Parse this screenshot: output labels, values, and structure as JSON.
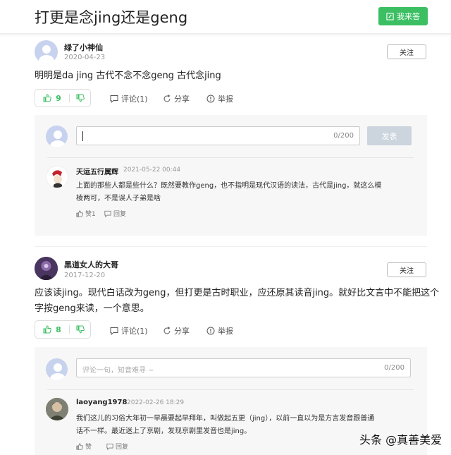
{
  "header": {
    "title": "打更是念jing还是geng",
    "answer_label": "我来答"
  },
  "answers": [
    {
      "user": "绿了小神仙",
      "date": "2020-04-23",
      "follow": "关注",
      "content": "明明是da jing 古代不念不念geng 古代念jing",
      "likes": "9",
      "comment": "评论(1)",
      "share": "分享",
      "report": "举报",
      "input_count": "0/200",
      "publish": "发表",
      "reply": {
        "user": "天运五行属辉",
        "date": "2021-05-22 00:44",
        "text_line1": "上面的那些人都是些什么？既然要教作geng，也不指明是现代汉语的读法，古代是jing，就这么模",
        "text_line2": "棱两可，不是误人子弟是啥",
        "like": "赞1",
        "reply": "回复"
      }
    },
    {
      "user": "黑道女人的大哥",
      "date": "2017-12-20",
      "follow": "关注",
      "content_line1": "应该读jing。现代白话改为geng，但打更是古时职业，应还原其读音jing。就好比文言中不能把这个",
      "content_line2": "字按geng来读，一个意思。",
      "likes": "8",
      "comment": "评论(1)",
      "share": "分享",
      "report": "举报",
      "input_placeholder": "评论一句，知音难寻 ~",
      "input_count": "0/200",
      "reply": {
        "user": "laoyang1978",
        "date": "2022-02-26 18:29",
        "text_line1": "我们这儿的习俗大年初一早晨要起早拜年，叫做起五更（jing），以前一直以为是方言发音跟普通",
        "text_line2": "话不一样。最近迷上了京剧，发现京剧里发音也是jing。",
        "like": "赞",
        "reply": "回复"
      }
    }
  ],
  "watermark": "头条 @真善美爱",
  "colors": {
    "accent": "#3cbf63",
    "panel_bg": "#f7f7f7",
    "publish_disabled": "#ccd4de"
  }
}
